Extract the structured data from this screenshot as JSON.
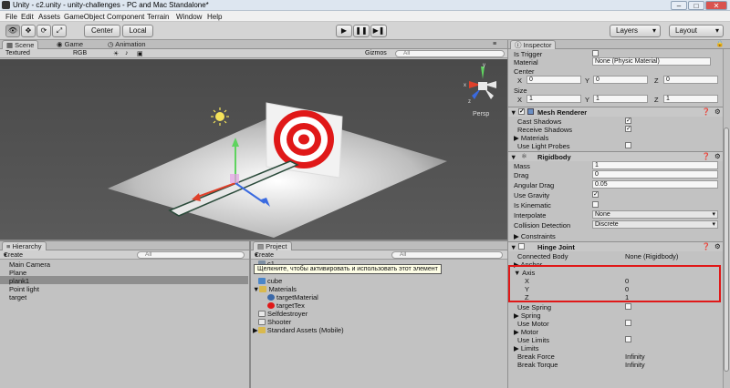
{
  "window": {
    "title": "Unity - c2.unity - unity-challenges - PC and Mac Standalone*",
    "min": "–",
    "max": "□",
    "close": "✕"
  },
  "menu": [
    "File",
    "Edit",
    "Assets",
    "GameObject",
    "Component",
    "Terrain",
    "Window",
    "Help"
  ],
  "toolbar": {
    "tools": [
      "👁",
      "✥",
      "⟳",
      "⤢"
    ],
    "center": "Center",
    "local": "Local",
    "play": "▶",
    "pause": "❚❚",
    "step": "▶❚",
    "layers": "Layers",
    "layout": "Layout"
  },
  "scene": {
    "tabs": [
      "Scene",
      "Game",
      "Animation"
    ],
    "render_mode": "Textured",
    "color_mode": "RGB",
    "gizmos": "Gizmos",
    "search_placeholder": "All",
    "persp_label": "Persp",
    "axis_x": "x",
    "axis_y": "y",
    "axis_z": "z"
  },
  "hierarchy": {
    "tab": "Hierarchy",
    "create": "Create",
    "search_placeholder": "All",
    "items": [
      "Main Camera",
      "Plane",
      "plank1",
      "Point light",
      "target"
    ],
    "selected": "plank1"
  },
  "project": {
    "tab": "Project",
    "create": "Create",
    "search_placeholder": "All",
    "tooltip": "Щелкните, чтобы активировать и использовать этот элемент",
    "items": [
      {
        "name": "c1",
        "indent": 0
      },
      {
        "name": "cube",
        "indent": 0
      },
      {
        "name": "Materials",
        "indent": 0
      },
      {
        "name": "targetMaterial",
        "indent": 1
      },
      {
        "name": "targetTex",
        "indent": 1
      },
      {
        "name": "Selfdestroyer",
        "indent": 0
      },
      {
        "name": "Shooter",
        "indent": 0
      },
      {
        "name": "Standard Assets (Mobile)",
        "indent": 0
      }
    ]
  },
  "inspector": {
    "tab": "Inspector",
    "box": {
      "is_trigger": "Is Trigger",
      "material_label": "Material",
      "material_value": "None (Physic Material)",
      "center": "Center",
      "center_x": "0",
      "center_y": "0",
      "center_z": "0",
      "size": "Size",
      "size_x": "1",
      "size_y": "1",
      "size_z": "1",
      "x": "X",
      "y": "Y",
      "z": "Z"
    },
    "mesh_renderer": {
      "title": "Mesh Renderer",
      "cast_shadows": "Cast Shadows",
      "receive_shadows": "Receive Shadows",
      "materials": "Materials",
      "use_light_probes": "Use Light Probes"
    },
    "rigidbody": {
      "title": "Rigidbody",
      "mass": "Mass",
      "mass_value": "1",
      "drag": "Drag",
      "drag_value": "0",
      "angular_drag": "Angular Drag",
      "angular_drag_value": "0.05",
      "use_gravity": "Use Gravity",
      "is_kinematic": "Is Kinematic",
      "interpolate": "Interpolate",
      "interpolate_value": "None",
      "collision_detection": "Collision Detection",
      "collision_detection_value": "Discrete",
      "constraints": "Constraints"
    },
    "hinge": {
      "title": "Hinge Joint",
      "connected_body": "Connected Body",
      "connected_body_value": "None (Rigidbody)",
      "anchor": "Anchor",
      "axis": "Axis",
      "axis_x_label": "X",
      "axis_x": "0",
      "axis_y_label": "Y",
      "axis_y": "0",
      "axis_z_label": "Z",
      "axis_z": "1",
      "use_spring": "Use Spring",
      "spring": "Spring",
      "use_motor": "Use Motor",
      "motor": "Motor",
      "use_limits": "Use Limits",
      "limits": "Limits",
      "break_force": "Break Force",
      "break_force_value": "Infinity",
      "break_torque": "Break Torque",
      "break_torque_value": "Infinity"
    }
  }
}
